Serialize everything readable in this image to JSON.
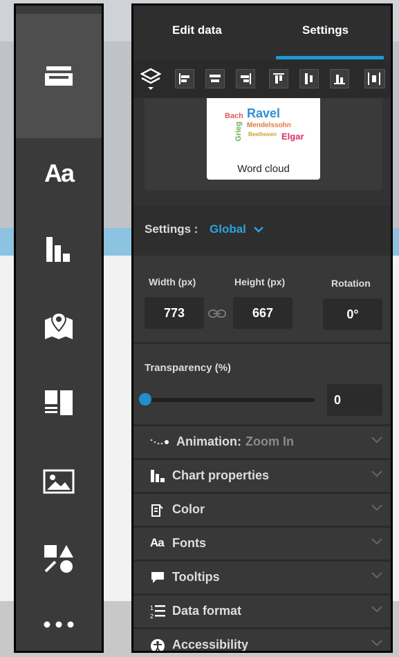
{
  "left_rail": {
    "items": [
      {
        "icon": "inbox-tray-icon",
        "active": true
      },
      {
        "icon": "text-aa-icon",
        "glyph": "Aa"
      },
      {
        "icon": "bar-chart-icon"
      },
      {
        "icon": "map-pin-icon"
      },
      {
        "icon": "layout-blocks-icon"
      },
      {
        "icon": "image-icon"
      },
      {
        "icon": "shapes-icon"
      },
      {
        "icon": "more-dots-icon"
      }
    ]
  },
  "tabs": {
    "edit_data": "Edit data",
    "settings": "Settings",
    "active": "settings"
  },
  "preview": {
    "label": "Word cloud",
    "words": {
      "bach": "Bach",
      "ravel": "Ravel",
      "mendelssohn": "Mendelssohn",
      "grieg": "Grieg",
      "beethoven": "Beethoven",
      "elgar": "Elgar"
    }
  },
  "settings": {
    "label": "Settings :",
    "value": "Global"
  },
  "dimensions": {
    "width_label": "Width (px)",
    "height_label": "Height (px)",
    "rotation_label": "Rotation",
    "width": "773",
    "height": "667",
    "rotation": "0°"
  },
  "transparency": {
    "label": "Transparency (%)",
    "value": "0"
  },
  "accordion": {
    "animation": {
      "label": "Animation:",
      "value": "Zoom In"
    },
    "chart_properties": "Chart properties",
    "color": "Color",
    "fonts": "Fonts",
    "tooltips": "Tooltips",
    "data_format": "Data format",
    "accessibility": "Accessibility"
  },
  "colors": {
    "accent": "#1a9ad6",
    "panel": "#323232",
    "rail": "#3a3a3a"
  }
}
